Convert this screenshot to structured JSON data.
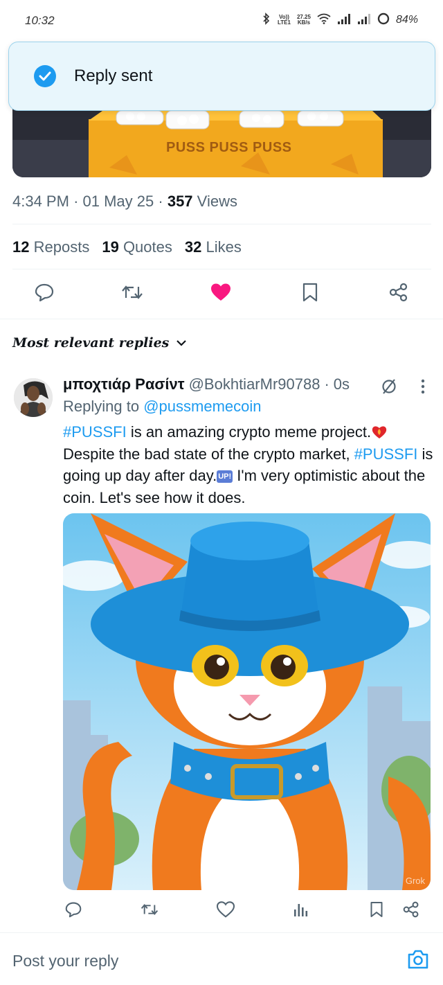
{
  "status_bar": {
    "time": "10:32",
    "network_top": "Vo))",
    "network_bottom": "LTE1",
    "speed_top": "27.25",
    "speed_bottom": "KB/s",
    "battery": "84%"
  },
  "toast": {
    "icon": "check-circle-icon",
    "text": "Reply sent"
  },
  "tweet": {
    "image_caption": "PUSS PUSS PUSS",
    "time": "4:34 PM",
    "date": "01 May 25",
    "views_count": "357",
    "views_label": "Views",
    "reposts_count": "12",
    "reposts_label": "Reposts",
    "quotes_count": "19",
    "quotes_label": "Quotes",
    "likes_count": "32",
    "likes_label": "Likes",
    "liked": true
  },
  "replies_filter": {
    "label": "Most relevant replies"
  },
  "reply": {
    "display_name": "μποχτιάρ Ρασίντ",
    "handle": "@BokhtiarMr90788",
    "age": "0s",
    "replying_prefix": "Replying to",
    "replying_to": "@pussmemecoin",
    "text_part1_tag": "#PUSSFI",
    "text_part2": " is an amazing crypto meme project.",
    "text_part3": " Despite the bad state of the crypto market, ",
    "text_part4_tag": "#PUSSFI",
    "text_part5": " is going up day after day.",
    "up_badge": "UP!",
    "text_part6": " I'm very optimistic about the coin. Let's see how it does.",
    "image_watermark": "Grok"
  },
  "composer": {
    "placeholder": "Post your reply"
  },
  "colors": {
    "accent": "#1d9bf0",
    "like": "#f91880",
    "secondary_text": "#536471"
  }
}
